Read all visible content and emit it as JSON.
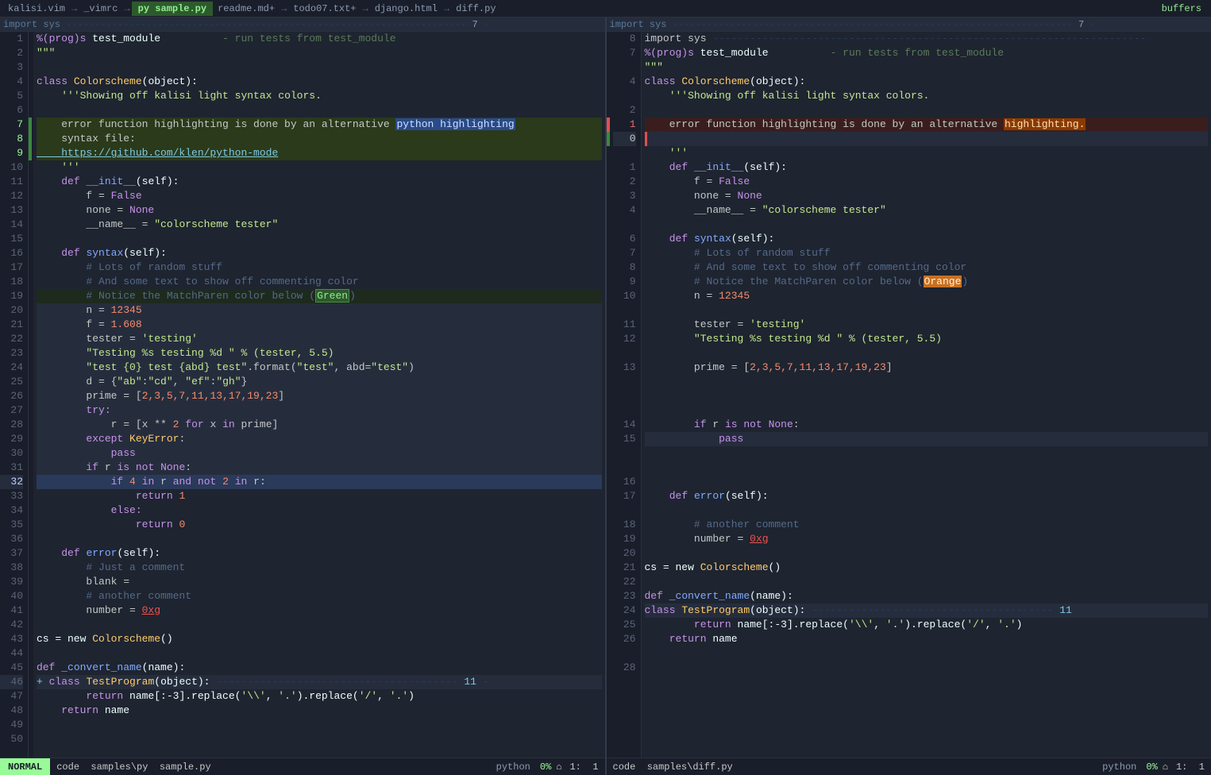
{
  "tabbar": {
    "items": [
      {
        "label": "kalisi.vim",
        "active": false,
        "color": "normal"
      },
      {
        "label": "→",
        "active": false,
        "color": "arrow"
      },
      {
        "label": "_vimrc",
        "active": false,
        "color": "normal"
      },
      {
        "label": "→",
        "active": false,
        "color": "arrow"
      },
      {
        "label": "py sample.py",
        "active": true,
        "color": "py"
      },
      {
        "label": "readme.md+",
        "active": false,
        "color": "normal"
      },
      {
        "label": "→",
        "active": false,
        "color": "arrow"
      },
      {
        "label": "todo07.txt+",
        "active": false,
        "color": "normal"
      },
      {
        "label": "→",
        "active": false,
        "color": "arrow"
      },
      {
        "label": "django.html",
        "active": false,
        "color": "normal"
      },
      {
        "label": "→",
        "active": false,
        "color": "arrow"
      },
      {
        "label": "diff.py",
        "active": false,
        "color": "normal"
      }
    ],
    "buffers": "buffers"
  },
  "pane_left": {
    "status_line": "import sys --------- 7 -",
    "lines": [
      {
        "num": "1",
        "content": "%(prog)s test_module          - run tests from test_module"
      },
      {
        "num": "2",
        "content": "\"\"\""
      },
      {
        "num": "3",
        "content": ""
      },
      {
        "num": "4",
        "content": "class Colorscheme(object):"
      },
      {
        "num": "5",
        "content": "    '''Showing off kalisi light syntax colors."
      },
      {
        "num": "6",
        "content": ""
      },
      {
        "num": "7",
        "content": "    error function highlighting is done by an alternative python highlighting"
      },
      {
        "num": "8",
        "content": "    syntax file:"
      },
      {
        "num": "9",
        "content": "    https://github.com/klen/python-mode"
      },
      {
        "num": "10",
        "content": "    '''"
      },
      {
        "num": "11",
        "content": "    def __init__(self):"
      },
      {
        "num": "12",
        "content": "        f = False"
      },
      {
        "num": "13",
        "content": "        none = None"
      },
      {
        "num": "14",
        "content": "        __name__ = \"colorscheme tester\""
      },
      {
        "num": "15",
        "content": ""
      },
      {
        "num": "16",
        "content": "    def syntax(self):"
      },
      {
        "num": "17",
        "content": "        # Lots of random stuff"
      },
      {
        "num": "18",
        "content": "        # And some text to show off commenting color"
      },
      {
        "num": "19",
        "content": "        # Notice the MatchParen color below (Green)"
      },
      {
        "num": "20",
        "content": "        n = 12345"
      },
      {
        "num": "21",
        "content": "        f = 1.608"
      },
      {
        "num": "22",
        "content": "        tester = 'testing'"
      },
      {
        "num": "23",
        "content": "        \"Testing %s testing %d \" % (tester, 5.5)"
      },
      {
        "num": "24",
        "content": "        \"test {0} test {abd} test\".format(\"test\", abd=\"test\")"
      },
      {
        "num": "25",
        "content": "        d = {\"ab\":\"cd\", \"ef\":\"gh\"}"
      },
      {
        "num": "26",
        "content": "        prime = [2,3,5,7,11,13,17,19,23]"
      },
      {
        "num": "27",
        "content": "        try:"
      },
      {
        "num": "28",
        "content": "            r = [x ** 2 for x in prime]"
      },
      {
        "num": "29",
        "content": "        except KeyError:"
      },
      {
        "num": "30",
        "content": "            pass"
      },
      {
        "num": "31",
        "content": "        if r is not None:"
      },
      {
        "num": "32",
        "content": "            if 4 in r and not 2 in r:"
      },
      {
        "num": "33",
        "content": "                return 1"
      },
      {
        "num": "34",
        "content": "            else:"
      },
      {
        "num": "35",
        "content": "                return 0"
      },
      {
        "num": "36",
        "content": ""
      },
      {
        "num": "37",
        "content": "    def error(self):"
      },
      {
        "num": "38",
        "content": "        # Just a comment"
      },
      {
        "num": "39",
        "content": "        blank ="
      },
      {
        "num": "40",
        "content": "        # another comment"
      },
      {
        "num": "41",
        "content": "        number = 0xg"
      },
      {
        "num": "42",
        "content": ""
      },
      {
        "num": "43",
        "content": "cs = new Colorscheme()"
      },
      {
        "num": "44",
        "content": ""
      },
      {
        "num": "45",
        "content": "def _convert_name(name):"
      },
      {
        "num": "46",
        "content": "class TestProgram(object):               ---------- 11 -"
      },
      {
        "num": "47",
        "content": "        return name[:-3].replace('\\\\', '.').replace('/', '.')"
      },
      {
        "num": "48",
        "content": "    return name"
      },
      {
        "num": "49",
        "content": ""
      },
      {
        "num": "50",
        "content": ""
      }
    ],
    "statusbar": {
      "mode": "NORMAL",
      "file": "code  samples\\py  sample.py",
      "filetype": "python",
      "percent": "0%",
      "cursor": "1:  1"
    }
  },
  "pane_right": {
    "status_line": "import sys --------- 7 -",
    "lines": [
      {
        "num": "8",
        "content": "import sys --------- 7 -"
      },
      {
        "num": "7",
        "content": "%(prog)s test_module          - run tests from test_module"
      },
      {
        "num": "",
        "content": "\"\"\""
      },
      {
        "num": "4",
        "content": "class Colorscheme(object):"
      },
      {
        "num": "",
        "content": "    '''Showing off kalisi light syntax colors."
      },
      {
        "num": "2",
        "content": ""
      },
      {
        "num": "1",
        "content": "    error function highlighting is done by an alternative highlighting."
      },
      {
        "num": "0",
        "content": ""
      },
      {
        "num": "",
        "content": "    '''"
      },
      {
        "num": "1",
        "content": "    def __init__(self):"
      },
      {
        "num": "2",
        "content": "        f = False"
      },
      {
        "num": "3",
        "content": "        none = None"
      },
      {
        "num": "4",
        "content": "        __name__ = \"colorscheme tester\""
      },
      {
        "num": "",
        "content": ""
      },
      {
        "num": "6",
        "content": "    def syntax(self):"
      },
      {
        "num": "7",
        "content": "        # Lots of random stuff"
      },
      {
        "num": "8",
        "content": "        # And some text to show off commenting color"
      },
      {
        "num": "9",
        "content": "        # Notice the MatchParen color below (Orange)"
      },
      {
        "num": "10",
        "content": "        n = 12345"
      },
      {
        "num": "",
        "content": ""
      },
      {
        "num": "11",
        "content": "        tester = 'testing'"
      },
      {
        "num": "12",
        "content": "        \"Testing %s testing %d \" % (tester, 5.5)"
      },
      {
        "num": "",
        "content": ""
      },
      {
        "num": "13",
        "content": "        prime = [2,3,5,7,11,13,17,19,23]"
      },
      {
        "num": "",
        "content": ""
      },
      {
        "num": "",
        "content": ""
      },
      {
        "num": "",
        "content": ""
      },
      {
        "num": "14",
        "content": "        if r is not None:"
      },
      {
        "num": "15",
        "content": "            pass"
      },
      {
        "num": "",
        "content": ""
      },
      {
        "num": "",
        "content": ""
      },
      {
        "num": "16",
        "content": ""
      },
      {
        "num": "17",
        "content": "    def error(self):"
      },
      {
        "num": "",
        "content": ""
      },
      {
        "num": "18",
        "content": "        # another comment"
      },
      {
        "num": "19",
        "content": "        number = 0xg"
      },
      {
        "num": "20",
        "content": ""
      },
      {
        "num": "21",
        "content": "cs = new Colorscheme()"
      },
      {
        "num": "22",
        "content": ""
      },
      {
        "num": "23",
        "content": "def _convert_name(name):"
      },
      {
        "num": "24",
        "content": "class TestProgram(object):               ---------- 11"
      },
      {
        "num": "25",
        "content": "        return name[:-3].replace('\\\\', '.').replace('/', '.')"
      },
      {
        "num": "26",
        "content": "    return name"
      },
      {
        "num": "",
        "content": ""
      },
      {
        "num": "28",
        "content": ""
      }
    ],
    "statusbar": {
      "mode": "",
      "file": "code  samples\\diff.py",
      "filetype": "python",
      "percent": "0%",
      "cursor": "1:  1"
    }
  }
}
